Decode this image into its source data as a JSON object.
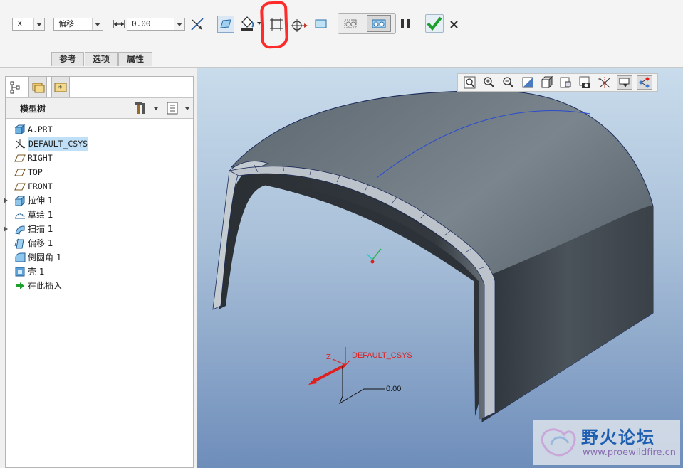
{
  "dashboard": {
    "axis_select": "X",
    "type_select": "偏移",
    "offset_value": "0.00",
    "tabs": [
      "参考",
      "选项",
      "属性"
    ]
  },
  "model_tree": {
    "title": "模型树",
    "items": [
      {
        "label": "A.PRT",
        "icon": "part-icon",
        "cn": false,
        "expandable": false,
        "selected": false
      },
      {
        "label": "DEFAULT_CSYS",
        "icon": "csys-icon",
        "cn": false,
        "expandable": false,
        "selected": true
      },
      {
        "label": "RIGHT",
        "icon": "datum-plane-icon",
        "cn": false,
        "expandable": false,
        "selected": false
      },
      {
        "label": "TOP",
        "icon": "datum-plane-icon",
        "cn": false,
        "expandable": false,
        "selected": false
      },
      {
        "label": "FRONT",
        "icon": "datum-plane-icon",
        "cn": false,
        "expandable": false,
        "selected": false
      },
      {
        "label": "拉伸  1",
        "icon": "extrude-icon",
        "cn": true,
        "expandable": true,
        "selected": false
      },
      {
        "label": "草绘  1",
        "icon": "sketch-icon",
        "cn": true,
        "expandable": false,
        "selected": false
      },
      {
        "label": "扫描  1",
        "icon": "sweep-icon",
        "cn": true,
        "expandable": true,
        "selected": false
      },
      {
        "label": "偏移  1",
        "icon": "offset-icon",
        "cn": true,
        "expandable": false,
        "selected": false
      },
      {
        "label": "倒圆角  1",
        "icon": "round-icon",
        "cn": true,
        "expandable": false,
        "selected": false
      },
      {
        "label": "壳  1",
        "icon": "shell-icon",
        "cn": true,
        "expandable": false,
        "selected": false
      },
      {
        "label": "在此插入",
        "icon": "insert-here-icon",
        "cn": true,
        "expandable": false,
        "selected": false
      }
    ]
  },
  "viewport": {
    "csys_label": "DEFAULT_CSYS",
    "dimension_value": "0.00",
    "axis_z_label": "Z"
  },
  "watermark": {
    "title": "野火论坛",
    "url": "www.proewildfire.cn"
  },
  "colors": {
    "annotation_red": "#ff2a2a",
    "confirm_green": "#1e9e2c",
    "selection_blue": "#bfe0f7",
    "csys_red": "#e02020"
  }
}
